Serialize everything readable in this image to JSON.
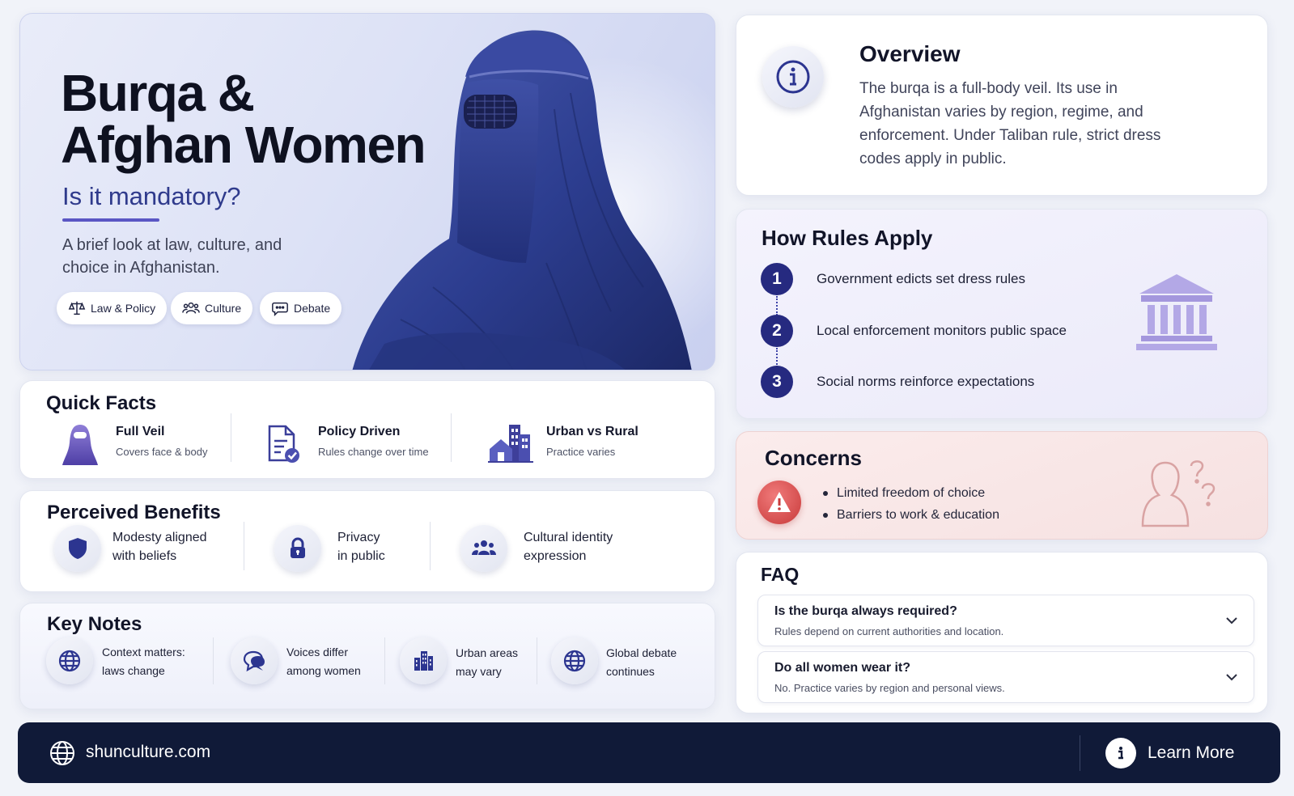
{
  "hero": {
    "title_line1": "Burqa &",
    "title_line2": "Afghan Women",
    "subtitle": "Is it mandatory?",
    "description": "A brief look at law, culture, and choice in Afghanistan.",
    "chips": [
      {
        "label": "Law & Policy",
        "icon": "scales-icon"
      },
      {
        "label": "Culture",
        "icon": "people-icon"
      },
      {
        "label": "Debate",
        "icon": "speech-bubble-icon"
      }
    ]
  },
  "quick_facts": {
    "title": "Quick Facts",
    "items": [
      {
        "title": "Full Veil",
        "subtitle": "Covers face & body",
        "icon": "veil-icon"
      },
      {
        "title": "Policy Driven",
        "subtitle": "Rules change over time",
        "icon": "document-check-icon"
      },
      {
        "title": "Urban vs Rural",
        "subtitle": "Practice varies",
        "icon": "city-house-icon"
      }
    ]
  },
  "benefits": {
    "title": "Perceived Benefits",
    "items": [
      {
        "line1": "Modesty aligned",
        "line2": "with beliefs",
        "icon": "shield-icon"
      },
      {
        "line1": "Privacy",
        "line2": "in public",
        "icon": "lock-icon"
      },
      {
        "line1": "Cultural identity",
        "line2": "expression",
        "icon": "group-icon"
      }
    ]
  },
  "key_notes": {
    "title": "Key Notes",
    "items": [
      {
        "line1": "Context matters:",
        "line2": "laws change",
        "icon": "globe-icon"
      },
      {
        "line1": "Voices differ",
        "line2": "among women",
        "icon": "chat-icon"
      },
      {
        "line1": "Urban areas",
        "line2": "may vary",
        "icon": "buildings-icon"
      },
      {
        "line1": "Global debate",
        "line2": "continues",
        "icon": "globe-icon"
      }
    ]
  },
  "overview": {
    "title": "Overview",
    "body": "The burqa is a full-body veil. Its use in Afghanistan varies by region, regime, and enforcement. Under Taliban rule, strict dress codes apply in public."
  },
  "rules": {
    "title": "How Rules Apply",
    "steps": [
      {
        "num": "1",
        "text": "Government edicts set dress rules"
      },
      {
        "num": "2",
        "text": "Local enforcement monitors public space"
      },
      {
        "num": "3",
        "text": "Social norms reinforce expectations"
      }
    ]
  },
  "concerns": {
    "title": "Concerns",
    "items": [
      "Limited freedom of choice",
      "Barriers to work & education"
    ]
  },
  "faq": {
    "title": "FAQ",
    "items": [
      {
        "q": "Is the burqa always required?",
        "a": "Rules depend on current authorities and location."
      },
      {
        "q": "Do all women wear it?",
        "a": "No. Practice varies by region and personal views."
      }
    ]
  },
  "footer": {
    "site": "shunculture.com",
    "button": "Learn More"
  },
  "colors": {
    "accent": "#262a80",
    "burqa_blue": "#2c3d8f",
    "footer_bg": "#101a38",
    "concern_red": "#c83a3a"
  }
}
